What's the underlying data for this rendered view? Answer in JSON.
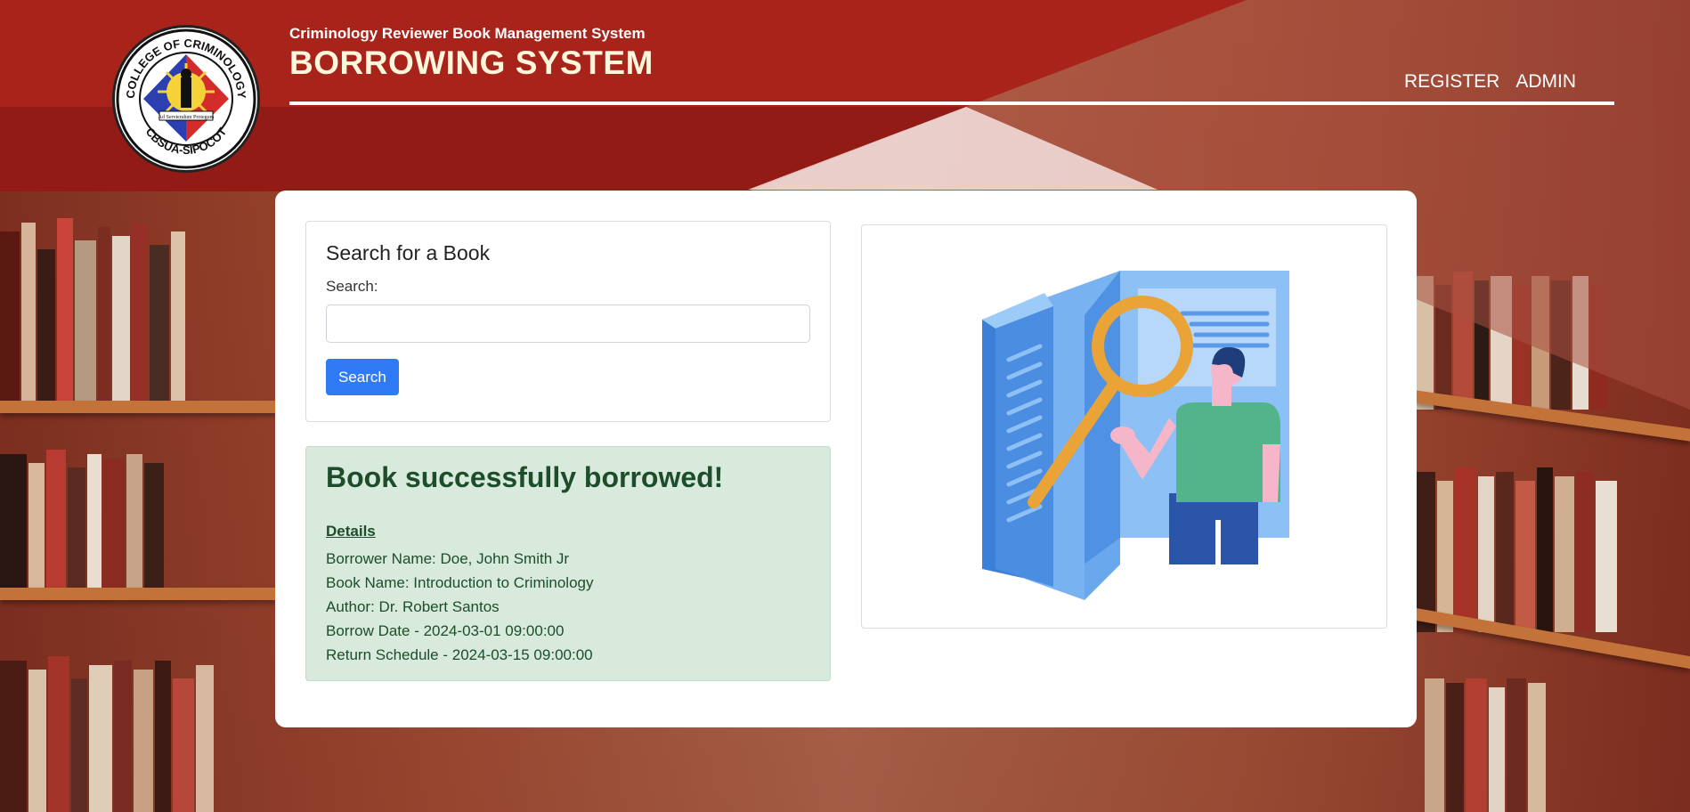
{
  "header": {
    "subtitle": "Criminology Reviewer Book Management System",
    "title": "BORROWING SYSTEM",
    "logo_text_top": "COLLEGE OF CRIMINOLOGY",
    "logo_text_bottom": "CBSUA-SIPOCOT",
    "logo_motto": "Ad Serviendum Protegum",
    "nav": [
      {
        "label": "REGISTER"
      },
      {
        "label": "ADMIN"
      }
    ]
  },
  "search": {
    "heading": "Search for a Book",
    "label": "Search:",
    "input_value": "",
    "button_label": "Search"
  },
  "result": {
    "heading": "Book successfully borrowed!",
    "details_title": "Details",
    "lines": [
      {
        "label": "Borrower Name",
        "sep": ": ",
        "value": "Doe, John Smith Jr"
      },
      {
        "label": "Book Name",
        "sep": ": ",
        "value": "Introduction to Criminology"
      },
      {
        "label": "Author",
        "sep": ": ",
        "value": "Dr. Robert Santos"
      },
      {
        "label": "Borrow Date",
        "sep": " - ",
        "value": "2024-03-01 09:00:00"
      },
      {
        "label": "Return Schedule",
        "sep": " - ",
        "value": "2024-03-15 09:00:00"
      }
    ]
  },
  "icons": {
    "logo": "college-seal-icon",
    "illustration": "book-search-illustration"
  },
  "colors": {
    "header_red": "#a8241a",
    "title_cream": "#fff6dc",
    "button_blue": "#2f7bf6",
    "success_bg": "#d7eadc",
    "success_text": "#1e4d2b"
  }
}
